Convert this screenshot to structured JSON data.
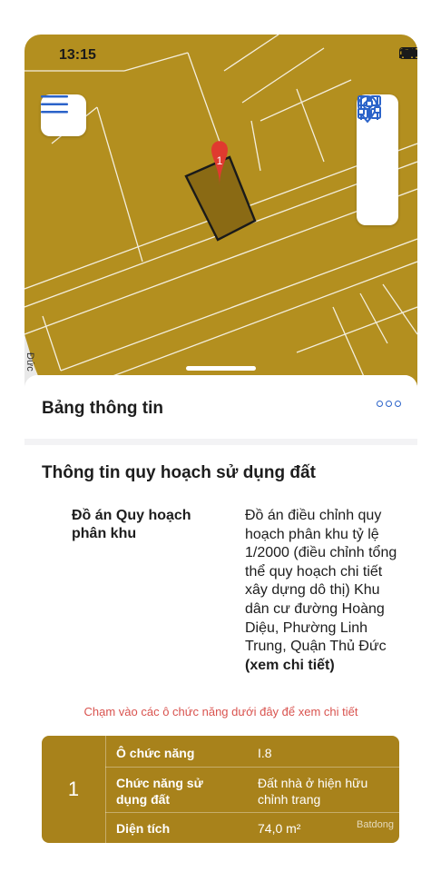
{
  "status_bar": {
    "time": "13:15"
  },
  "map": {
    "marker_label": "1",
    "road_label": "Đức",
    "colors": {
      "land": "#b38f1f",
      "parcel": "#8a6a14",
      "marker": "#e03a2f"
    }
  },
  "panel": {
    "title": "Bảng thông tin",
    "section_title": "Thông tin quy hoạch sử dụng đất",
    "plan_label": "Đồ án Quy hoạch phân khu",
    "plan_value": "Đồ án điều chỉnh quy hoạch phân khu tỷ lệ 1/2000 (điều chỉnh tổng thể quy hoạch chi tiết xây dựng dô thị) Khu dân cư đường Hoàng Diệu, Phường Linh Trung, Quận Thủ Đức",
    "plan_link": "(xem chi tiết)",
    "hint": "Chạm vào các ô chức năng dưới đây để xem chi tiết"
  },
  "function_table": {
    "index": "1",
    "rows": [
      {
        "key": "Ô chức năng",
        "value": "I.8"
      },
      {
        "key": "Chức năng sử dụng đất",
        "value": "Đất nhà ở hiện hữu chỉnh trang"
      },
      {
        "key": "Diện tích",
        "value": "74,0 m²"
      }
    ],
    "watermark": "Batdong"
  }
}
